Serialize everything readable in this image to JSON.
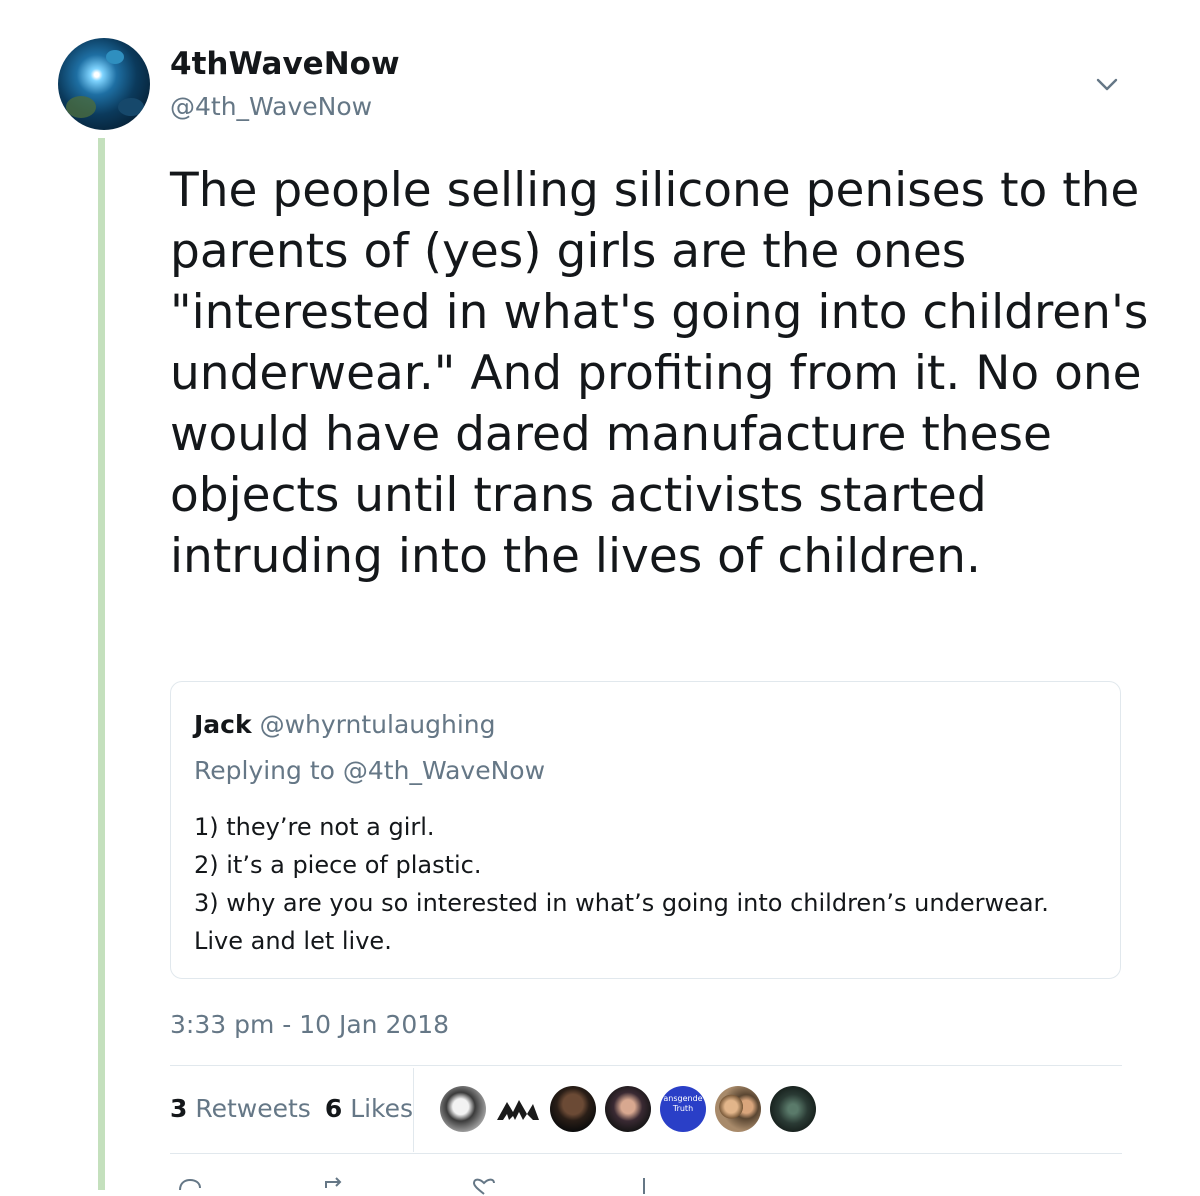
{
  "tweet": {
    "display_name": "4thWaveNow",
    "handle": "@4th_WaveNow",
    "text": "The people selling silicone penises to the parents of (yes) girls are the ones \"interested in what's going into children's underwear.\" And profiting from it. No one would have dared manufacture these objects until trans activists started intruding into the lives of children.",
    "timestamp": "3:33 pm - 10 Jan 2018"
  },
  "quoted": {
    "name": "Jack",
    "handle": "@whyrntulaughing",
    "replying_prefix": "Replying to",
    "replying_to": "@4th_WaveNow",
    "lines": [
      "1) they’re not a girl.",
      "2) it’s a piece of plastic.",
      "3) why are you so interested in what’s going into children’s underwear. Live and let live."
    ]
  },
  "stats": {
    "retweets_count": "3",
    "retweets_label": "Retweets",
    "likes_count": "6",
    "likes_label": "Likes"
  },
  "likers": [
    {
      "icon": "avatar-dog-photo"
    },
    {
      "icon": "avatar-mountain-logo"
    },
    {
      "icon": "avatar-man-dark"
    },
    {
      "icon": "avatar-woman"
    },
    {
      "icon": "avatar-transgender-truth-badge",
      "badge_text_1": "ansgende",
      "badge_text_2": "Truth"
    },
    {
      "icon": "avatar-couple"
    },
    {
      "icon": "avatar-forest"
    }
  ],
  "colors": {
    "thread_line": "#c4e0bd",
    "secondary_text": "#657786",
    "primary_text": "#14171a",
    "border": "#e1e8ed"
  }
}
